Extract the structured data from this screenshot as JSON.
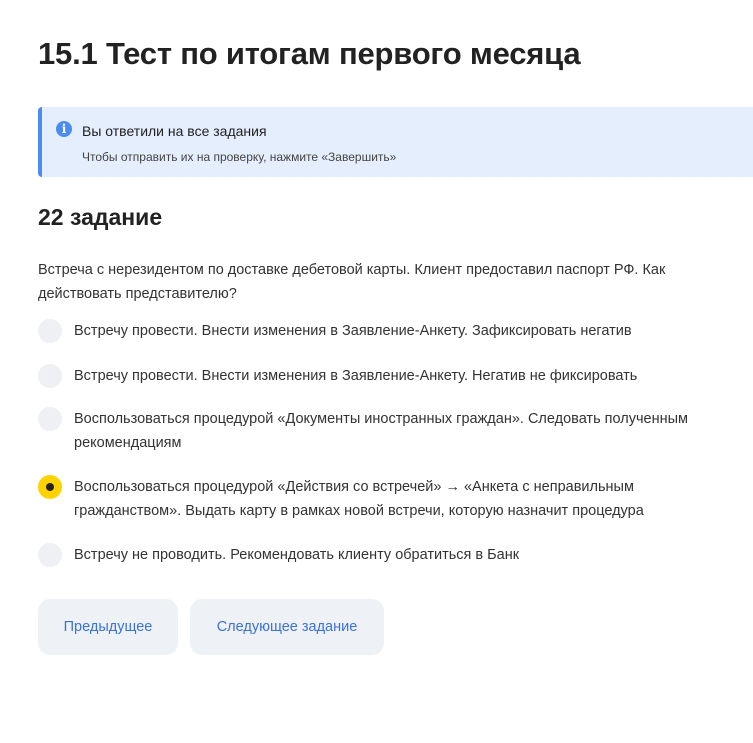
{
  "page": {
    "title": "15.1 Тест по итогам первого месяца"
  },
  "notice": {
    "icon": "info-icon",
    "icon_glyph": "i",
    "title": "Вы ответили на все задания",
    "text": "Чтобы отправить их на проверку, нажмите «Завершить»",
    "accent_color": "#4a8cf0",
    "background_color": "#e4eefc"
  },
  "task": {
    "heading": "22 задание",
    "question": "Встреча с нерезидентом по доставке дебетовой карты. Клиент предоставил паспорт РФ. Как действовать представителю?",
    "options": [
      {
        "label": "Встречу провести. Внести изменения в Заявление-Анкету. Зафиксировать негатив",
        "selected": false
      },
      {
        "label": "Встречу провести. Внести изменения в Заявление-Анкету. Негатив не фиксировать",
        "selected": false
      },
      {
        "label": "Воспользоваться процедурой «Документы иностранных граждан». Следовать полученным рекомендациям",
        "selected": false
      },
      {
        "label": "Воспользоваться процедурой «Действия со встречей» → «Анкета с неправильным гражданством». Выдать карту в рамках новой встречи, которую назначит процедура",
        "selected": true
      },
      {
        "label": "Встречу не проводить. Рекомендовать клиенту обратиться в Банк",
        "selected": false
      }
    ],
    "selected_color": "#ffd200"
  },
  "nav": {
    "prev_label": "Предыдущее",
    "next_label": "Следующее задание",
    "link_color": "#3a72d6"
  }
}
